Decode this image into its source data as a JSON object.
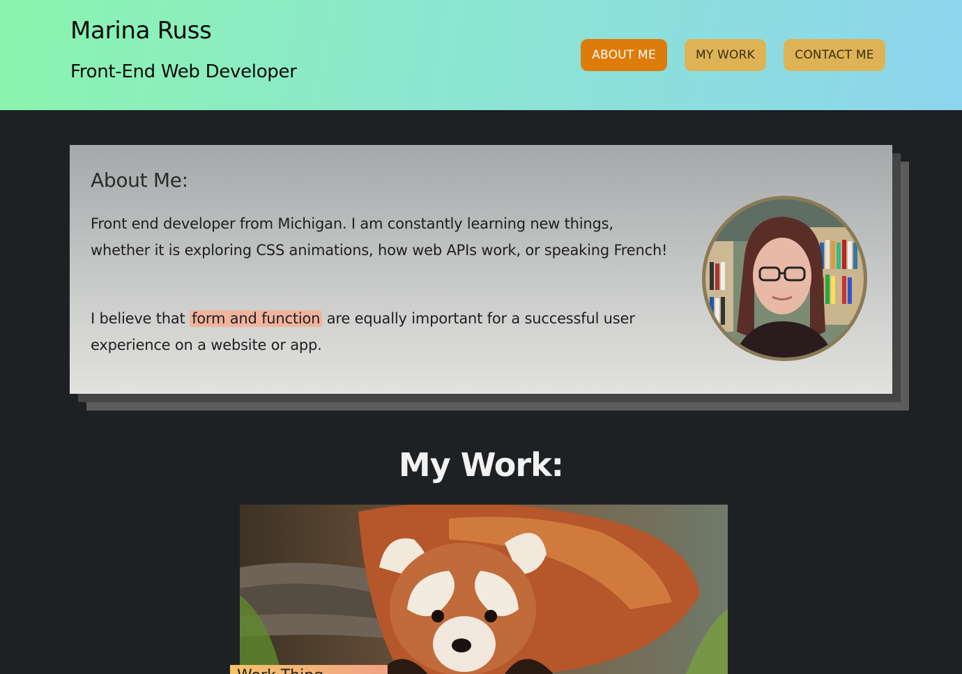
{
  "header": {
    "name": "Marina Russ",
    "role": "Front-End Web Developer"
  },
  "nav": {
    "about": "ABOUT ME",
    "work": "MY WORK",
    "contact": "CONTACT ME",
    "active": "about"
  },
  "about": {
    "title": "About Me:",
    "paragraph1": "Front end developer from Michigan. I am constantly learning new things, whether it is exploring CSS animations, how web APIs work, or speaking French!",
    "paragraph2_before": "I believe that",
    "paragraph2_highlight": "form and function",
    "paragraph2_after": "are equally important for a successful user experience on a website or app."
  },
  "work": {
    "title": "My Work:",
    "first_project_label": "Work Thing"
  },
  "colors": {
    "nav_active": "#de7c09",
    "nav_inactive": "#ddb355",
    "page_background": "#1e2124",
    "highlight": "#f0b49e"
  },
  "icons": {
    "avatar": "profile-photo",
    "project_image": "red-panda-photo"
  }
}
